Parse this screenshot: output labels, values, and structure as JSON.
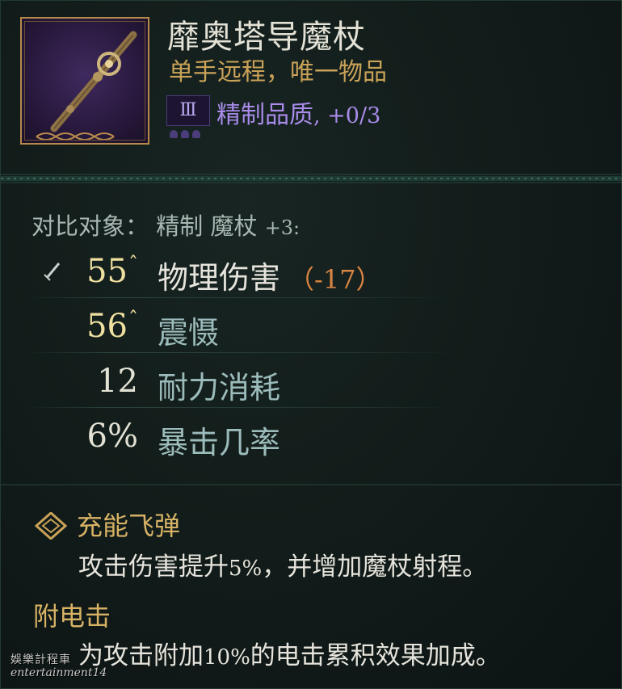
{
  "item": {
    "name": "靡奥塔导魔杖",
    "type": "单手远程，唯一物品",
    "rarity_numeral": "Ⅲ",
    "quality_label": "精制品质",
    "quality_value": ", +0/3",
    "icon": "magic-wand-icon"
  },
  "compare": {
    "label": "对比对象：",
    "target": "精制 魔杖",
    "level": "+3:"
  },
  "stats": [
    {
      "value": "55",
      "caret": "ˆ",
      "label": "物理伤害",
      "delta": "（-17）"
    },
    {
      "value": "56",
      "caret": "ˆ",
      "label": "震慑"
    },
    {
      "value": "12",
      "label": "耐力消耗"
    },
    {
      "value": "6%",
      "label": "暴击几率"
    }
  ],
  "ability": {
    "title": "充能飞弹",
    "desc_pre": "攻击伤害提升",
    "desc_num": "5%",
    "desc_post": "，并增加魔杖射程。"
  },
  "effect": {
    "title": "附电击",
    "desc_pre": "为攻击附加",
    "desc_num": "10%",
    "desc_post": "的电击累积效果加成。"
  },
  "watermark": {
    "line1": "娛樂計程車",
    "line2": "entertainment14"
  },
  "colors": {
    "background": "#111b19",
    "title": "#e4e2d6",
    "subtitle_gold": "#c9a258",
    "rarity_purple": "#a98bea",
    "delta_orange": "#d98443",
    "stat_muted": "#9cbcbc"
  }
}
